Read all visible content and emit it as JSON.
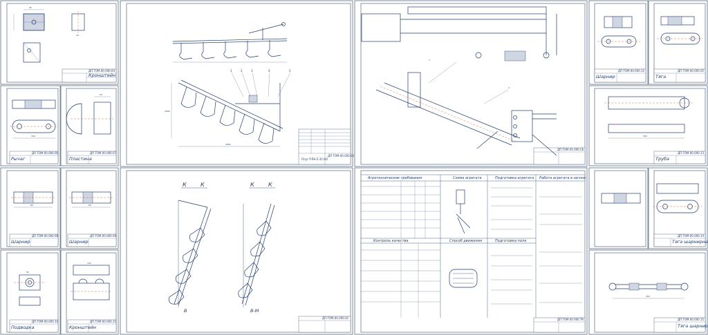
{
  "sheets": {
    "kronshtein": {
      "stamp": "ДП.ТОМ.00.000.04",
      "name": "Кронштейн"
    },
    "rychag": {
      "stamp": "ДП.ТОМ.00.000.06",
      "name": "Рычаг"
    },
    "plastina": {
      "stamp": "ДП.ТОМ.00.000.07",
      "name": "Пластина"
    },
    "sharnir1": {
      "stamp": "ДП.ТОМ.00.000.08",
      "name": "Шарнир"
    },
    "sharnir2": {
      "stamp": "ДП.ТОМ.00.000.09",
      "name": "Шарнир"
    },
    "podvodka": {
      "stamp": "ДП.ТОМ.00.000.10",
      "name": "Подводка"
    },
    "kronshtein2": {
      "stamp": "ДП.ТОМ.00.000.11",
      "name": "Кронштейн"
    },
    "main_plow": {
      "stamp": "ДП.ТОМ.00.000.00",
      "name": "Плуг ПЛН-5-35 ВО"
    },
    "assembly": {
      "stamp": "ДП.ТОМ.00.000.СБ",
      "name": ""
    },
    "plan_view": {
      "stamp": "ДП.ТОМ.00.000.02",
      "name": ""
    },
    "tyaga": {
      "stamp": "ДП.ТОМ.00.000.05",
      "name": "Тяга"
    },
    "sharnir3": {
      "stamp": "ДП.ТОМ.00.000.12",
      "name": "Шарнир"
    },
    "truba": {
      "stamp": "ДП.ТОМ.00.000.13",
      "name": "Труба"
    },
    "tyaga_sharnir": {
      "stamp": "ДП.ТОМ.00.000.14",
      "name": "Тяга шарнирная"
    },
    "tech": {
      "stamp": "ДП.ТОМ.00.000.ТК",
      "name": ""
    },
    "tyaga_main": {
      "stamp": "ДП.ТОМ.00.000.15",
      "name": "Тяга шарнирная"
    }
  },
  "tech_sheet": {
    "col1_title": "Агротехнические требования",
    "col2_title": "Схема агрегата",
    "col3_title": "Подготовка агрегата",
    "col4_title": "Работа агрегата в загоне",
    "sub_title_1": "Контроль качества",
    "sub_title_2": "Способ движения",
    "sub_title_3": "Подготовка поля"
  },
  "section_labels": {
    "k1": "К",
    "k2": "К",
    "b": "В",
    "bm": "В-М"
  }
}
